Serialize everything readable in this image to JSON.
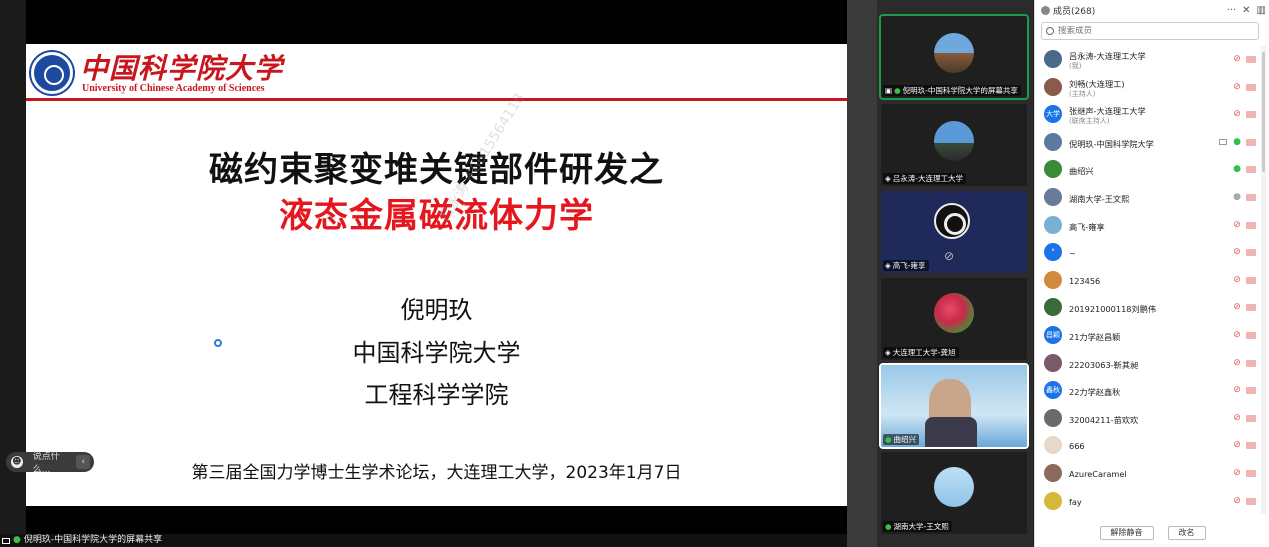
{
  "slide": {
    "logo_cn": "中国科学院大学",
    "logo_en": "University of Chinese Academy of Sciences",
    "title_line1": "磁约束聚变堆关键部件研发之",
    "title_line2": "液态金属磁流体力学",
    "author": "倪明玖",
    "institution1": "中国科学院大学",
    "institution2": "工程科学学院",
    "footer": "第三届全国力学博士生学术论坛，大连理工大学，2023年1月7日",
    "watermark": "吕永涛 +8615564118",
    "accent_color": "#e5161d"
  },
  "chat": {
    "placeholder": "说点什么...",
    "collapse_icon": "chevron-left-icon"
  },
  "status_bar": {
    "text": "倪明玖-中国科学院大学的屏幕共享"
  },
  "video_tiles": [
    {
      "label": "倪明玖-中国科学院大学的屏幕共享",
      "active": true,
      "mic": "on"
    },
    {
      "label": "吕永涛-大连理工大学",
      "mic": "off"
    },
    {
      "label": "高飞-雍享",
      "mic": "off"
    },
    {
      "label": "大连理工大学-龚旭",
      "mic": "off"
    },
    {
      "label": "曲绍兴",
      "mic": "on"
    },
    {
      "label": "湖南大学-王文熙",
      "mic": "on"
    }
  ],
  "members_panel": {
    "title": "成员(268)",
    "search_placeholder": "搜索成员",
    "members": [
      {
        "name": "吕永涛-大连理工大学",
        "role": "(我)",
        "avatar_text": "",
        "avatar_color": "#4a6a8a",
        "mic": "muted",
        "cam": "muted"
      },
      {
        "name": "刘畅(大连理工)",
        "role": "(主持人)",
        "avatar_text": "",
        "avatar_color": "#8a5a4a",
        "mic": "muted",
        "cam": "muted"
      },
      {
        "name": "张继声-大连理工大学",
        "role": "(联席主持人)",
        "avatar_text": "大学",
        "avatar_color": "#1a73e8",
        "mic": "muted",
        "cam": "muted"
      },
      {
        "name": "倪明玖-中国科学院大学",
        "role": "",
        "avatar_text": "",
        "avatar_color": "#5a7aa0",
        "mic": "on",
        "cam": "muted",
        "sharing": true
      },
      {
        "name": "曲绍兴",
        "role": "",
        "avatar_text": "",
        "avatar_color": "#3a8a3a",
        "mic": "on",
        "cam": "muted"
      },
      {
        "name": "湖南大学-王文熙",
        "role": "",
        "avatar_text": "",
        "avatar_color": "#6a7a9a",
        "mic": "idle",
        "cam": "muted"
      },
      {
        "name": "高飞-雍享",
        "role": "",
        "avatar_text": "",
        "avatar_color": "#7ab0d0",
        "mic": "muted",
        "cam": "muted"
      },
      {
        "name": "~",
        "role": "",
        "avatar_text": "°",
        "avatar_color": "#1a73e8",
        "mic": "muted",
        "cam": "muted"
      },
      {
        "name": "123456",
        "role": "",
        "avatar_text": "",
        "avatar_color": "#d08a3a",
        "mic": "muted",
        "cam": "muted"
      },
      {
        "name": "201921000118刘鹏伟",
        "role": "",
        "avatar_text": "",
        "avatar_color": "#3a6a3a",
        "mic": "muted",
        "cam": "muted"
      },
      {
        "name": "21力学赵昌颖",
        "role": "",
        "avatar_text": "昌颖",
        "avatar_color": "#1a73e8",
        "mic": "muted",
        "cam": "muted"
      },
      {
        "name": "22203063-靳其昶",
        "role": "",
        "avatar_text": "",
        "avatar_color": "#7a5a6a",
        "mic": "muted",
        "cam": "muted"
      },
      {
        "name": "22力学赵鑫秋",
        "role": "",
        "avatar_text": "鑫秋",
        "avatar_color": "#1a73e8",
        "mic": "muted",
        "cam": "muted"
      },
      {
        "name": "32004211-苗欢欢",
        "role": "",
        "avatar_text": "",
        "avatar_color": "#6a6a6a",
        "mic": "muted",
        "cam": "muted"
      },
      {
        "name": "666",
        "role": "",
        "avatar_text": "",
        "avatar_color": "#e8d8c8",
        "mic": "muted",
        "cam": "muted"
      },
      {
        "name": "AzureCaramel",
        "role": "",
        "avatar_text": "",
        "avatar_color": "#8a6a5a",
        "mic": "muted",
        "cam": "muted"
      },
      {
        "name": "fay",
        "role": "",
        "avatar_text": "",
        "avatar_color": "#d8b83a",
        "mic": "muted",
        "cam": "muted"
      }
    ],
    "unmute_all_label": "解除静音",
    "rename_label": "改名"
  }
}
